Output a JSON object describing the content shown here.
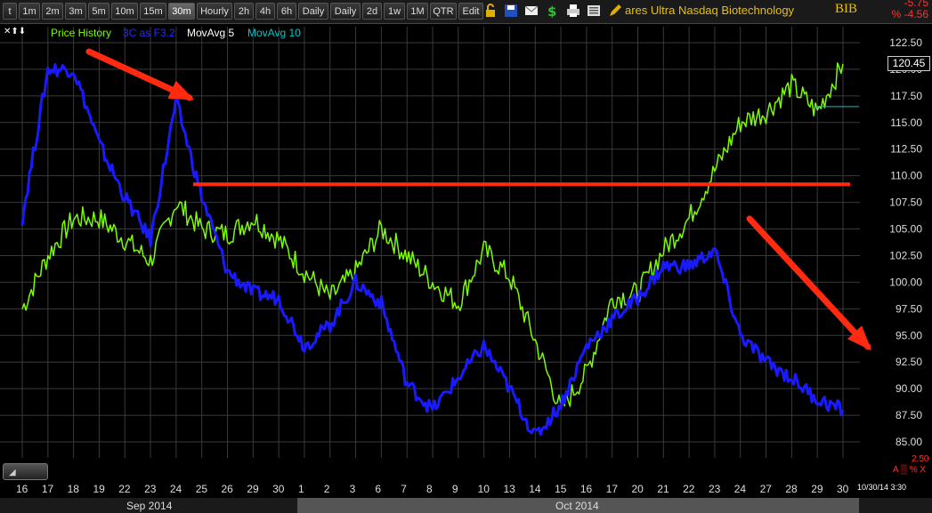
{
  "toolbar": {
    "timeframes": [
      "t",
      "1m",
      "2m",
      "3m",
      "5m",
      "10m",
      "15m",
      "30m",
      "Hourly",
      "2h",
      "4h",
      "6h",
      "Daily",
      "Daily",
      "2d",
      "1w",
      "1M",
      "QTR",
      "Edit"
    ],
    "active_timeframe": "30m",
    "symbol_name": "ares Ultra Nasdaq Biotechnology",
    "symbol": "BIB",
    "change_abs": "-5.75",
    "change_pct": "% -4.56"
  },
  "legend": {
    "price_history": "Price History",
    "indicator": "3C as F3.2",
    "mov5": "MovAvg 5",
    "mov10": "MovAvg 10",
    "colors": {
      "price": "#7cfc00",
      "indicator": "#1a1aff",
      "mov5": "#ffffff",
      "mov10": "#00c8c8"
    }
  },
  "price_badge": "120.45",
  "indicator_value": "2.50",
  "indicator_controls": "A ▒ % X",
  "timestamp": "10/30/14 3:30",
  "date_axis": {
    "days": [
      "16",
      "17",
      "18",
      "19",
      "22",
      "23",
      "24",
      "25",
      "26",
      "29",
      "30",
      "1",
      "2",
      "3",
      "6",
      "7",
      "8",
      "9",
      "10",
      "13",
      "14",
      "15",
      "16",
      "17",
      "20",
      "21",
      "22",
      "23",
      "24",
      "27",
      "28",
      "29",
      "30"
    ],
    "months": [
      "Sep 2014",
      "Oct 2014"
    ]
  },
  "chart_data": {
    "type": "line",
    "title": "",
    "ylim": [
      83.5,
      124
    ],
    "y_ticks": [
      "122.50",
      "120.00",
      "117.50",
      "115.00",
      "112.50",
      "110.00",
      "107.50",
      "105.00",
      "102.50",
      "100.00",
      "97.50",
      "95.00",
      "92.50",
      "90.00",
      "87.50",
      "85.00"
    ],
    "x": [
      "9/16",
      "9/17",
      "9/18",
      "9/19",
      "9/22",
      "9/23",
      "9/24",
      "9/25",
      "9/26",
      "9/29",
      "9/30",
      "10/1",
      "10/2",
      "10/3",
      "10/6",
      "10/7",
      "10/8",
      "10/9",
      "10/10",
      "10/13",
      "10/14",
      "10/15",
      "10/16",
      "10/17",
      "10/20",
      "10/21",
      "10/22",
      "10/23",
      "10/24",
      "10/27",
      "10/28",
      "10/29",
      "10/30"
    ],
    "series": [
      {
        "name": "Price History",
        "color": "#7cfc00",
        "values": [
          97.5,
          102.5,
          106,
          106,
          104,
          102,
          107.5,
          105,
          104.5,
          106,
          104,
          101,
          98.5,
          101,
          105,
          102.5,
          100,
          98,
          103,
          100.5,
          94.5,
          88,
          91.5,
          98.5,
          99,
          103,
          106,
          110.5,
          115,
          116,
          118.5,
          116,
          120.5
        ]
      },
      {
        "name": "3C as F3.2",
        "color": "#1a1aff",
        "values": [
          106,
          120,
          120,
          113,
          108,
          104,
          117,
          108,
          101,
          99,
          98.5,
          94,
          96,
          100,
          98,
          90.5,
          88,
          91,
          94,
          90,
          85.5,
          88.5,
          94,
          96.5,
          98.5,
          101.5,
          101.5,
          103,
          95,
          92.5,
          91,
          89,
          88
        ]
      }
    ],
    "annotations": {
      "resistance_level": 109.2,
      "arrows": [
        "down-arrow-sep",
        "down-arrow-oct"
      ]
    }
  }
}
